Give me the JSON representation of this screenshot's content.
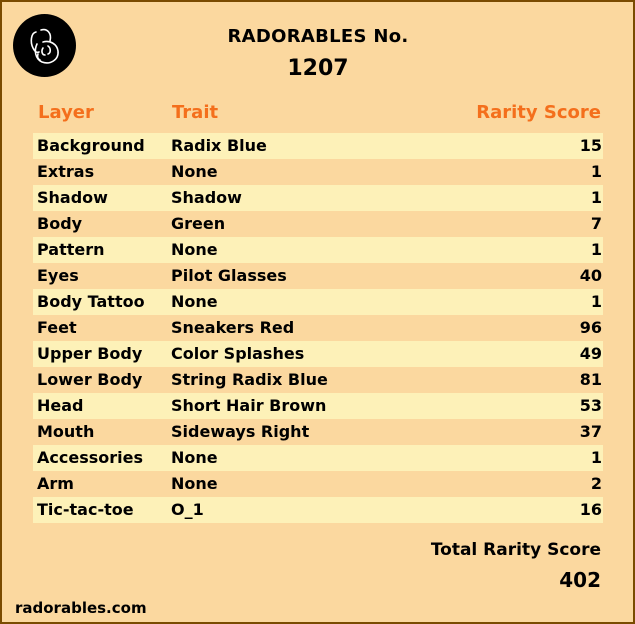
{
  "header": {
    "title": "RADORABLES No.",
    "number": "1207",
    "logo_icon": "bunny-head-icon"
  },
  "table": {
    "columns": {
      "layer": "Layer",
      "trait": "Trait",
      "score": "Rarity Score"
    },
    "rows": [
      {
        "layer": "Background",
        "trait": "Radix Blue",
        "score": "15"
      },
      {
        "layer": "Extras",
        "trait": "None",
        "score": "1"
      },
      {
        "layer": "Shadow",
        "trait": "Shadow",
        "score": "1"
      },
      {
        "layer": "Body",
        "trait": "Green",
        "score": "7"
      },
      {
        "layer": "Pattern",
        "trait": "None",
        "score": "1"
      },
      {
        "layer": "Eyes",
        "trait": "Pilot Glasses",
        "score": "40"
      },
      {
        "layer": "Body Tattoo",
        "trait": "None",
        "score": "1"
      },
      {
        "layer": "Feet",
        "trait": "Sneakers Red",
        "score": "96"
      },
      {
        "layer": "Upper Body",
        "trait": "Color Splashes",
        "score": "49"
      },
      {
        "layer": "Lower Body",
        "trait": "String Radix Blue",
        "score": "81"
      },
      {
        "layer": "Head",
        "trait": "Short Hair Brown",
        "score": "53"
      },
      {
        "layer": "Mouth",
        "trait": "Sideways Right",
        "score": "37"
      },
      {
        "layer": "Accessories",
        "trait": "None",
        "score": "1"
      },
      {
        "layer": "Arm",
        "trait": "None",
        "score": "2"
      },
      {
        "layer": "Tic-tac-toe",
        "trait": "O_1",
        "score": "16"
      }
    ]
  },
  "total": {
    "label": "Total Rarity Score",
    "value": "402"
  },
  "footer": {
    "website": "radorables.com"
  },
  "colors": {
    "background": "#fbd89f",
    "row_highlight": "#fdf1b8",
    "header_text": "#f46f1c",
    "border": "#7a4b00"
  }
}
